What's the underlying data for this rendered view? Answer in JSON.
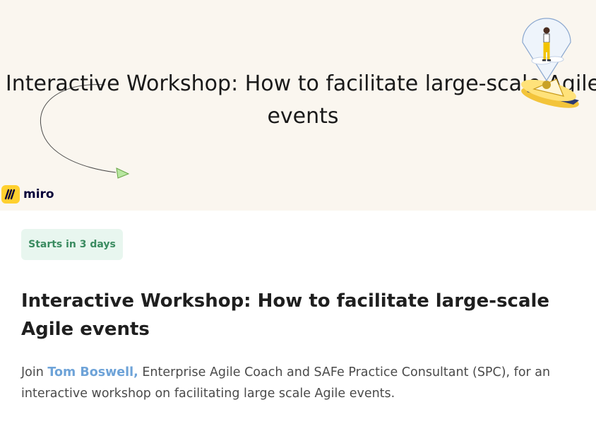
{
  "hero": {
    "title": "Interactive Workshop: How to facilitate large-scale Agile events",
    "brand": {
      "name": "miro",
      "logo_icon": "miro-logo-icon",
      "logo_color": "#ffd02f"
    },
    "background_color": "#faf6ef",
    "decorations": [
      "curved-arrow-icon",
      "person-on-map-pin-illustration"
    ]
  },
  "status": {
    "label": "Starts in 3 days",
    "color": "#3a8b60",
    "background": "#e8f6ef"
  },
  "event": {
    "title": "Interactive Workshop: How to facilitate large-scale Agile events",
    "description": {
      "prefix": "Join ",
      "speaker_link": "Tom Boswell,",
      "suffix": " Enterprise Agile Coach and SAFe Practice Consultant (SPC), for an interactive workshop on facilitating large scale Agile events."
    },
    "link_color": "#6ea3d8"
  }
}
